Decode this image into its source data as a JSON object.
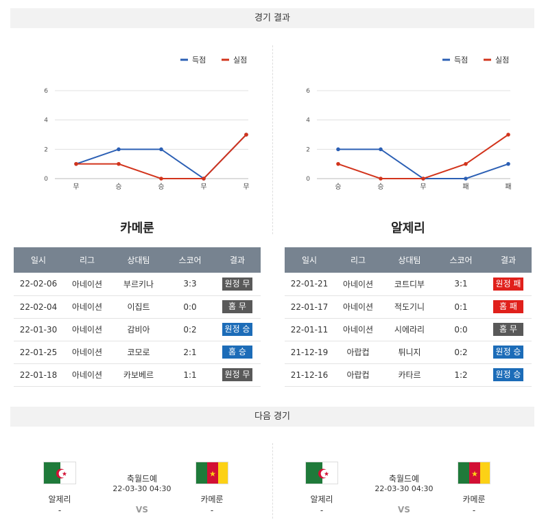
{
  "sections": {
    "results_title": "경기 결과",
    "next_title": "다음 경기"
  },
  "colors": {
    "scored": "#2b5fb4",
    "conceded": "#d2341c",
    "win": "#1c6cb8",
    "loss": "#e0201b",
    "draw": "#595959"
  },
  "chart_data": [
    {
      "type": "line",
      "categories": [
        "무",
        "승",
        "승",
        "무",
        "무"
      ],
      "series": [
        {
          "name": "득점",
          "values": [
            1,
            2,
            2,
            0,
            3
          ]
        },
        {
          "name": "실점",
          "values": [
            1,
            1,
            0,
            0,
            3
          ]
        }
      ],
      "yticks": [
        "0",
        "2",
        "4",
        "6"
      ],
      "ylim": [
        0,
        6
      ],
      "grid": true,
      "legend": "top-right"
    },
    {
      "type": "line",
      "categories": [
        "승",
        "승",
        "무",
        "패",
        "패"
      ],
      "series": [
        {
          "name": "득점",
          "values": [
            2,
            2,
            0,
            0,
            1
          ]
        },
        {
          "name": "실점",
          "values": [
            1,
            0,
            0,
            1,
            3
          ]
        }
      ],
      "yticks": [
        "0",
        "2",
        "4",
        "6"
      ],
      "ylim": [
        0,
        6
      ],
      "grid": true,
      "legend": "top-right"
    }
  ],
  "table_headers": [
    "일시",
    "리그",
    "상대팀",
    "스코어",
    "결과"
  ],
  "teams": [
    {
      "name": "카메룬",
      "rows": [
        {
          "date": "22-02-06",
          "league": "아네이션",
          "opponent": "부르키나",
          "score": "3:3",
          "result": "원정 무",
          "kind": "draw"
        },
        {
          "date": "22-02-04",
          "league": "아네이션",
          "opponent": "이집트",
          "score": "0:0",
          "result": "홈 무",
          "kind": "draw"
        },
        {
          "date": "22-01-30",
          "league": "아네이션",
          "opponent": "감비아",
          "score": "0:2",
          "result": "원정 승",
          "kind": "win"
        },
        {
          "date": "22-01-25",
          "league": "아네이션",
          "opponent": "코모로",
          "score": "2:1",
          "result": "홈 승",
          "kind": "win"
        },
        {
          "date": "22-01-18",
          "league": "아네이션",
          "opponent": "카보베르",
          "score": "1:1",
          "result": "원정 무",
          "kind": "draw"
        }
      ]
    },
    {
      "name": "알제리",
      "rows": [
        {
          "date": "22-01-21",
          "league": "아네이션",
          "opponent": "코트디부",
          "score": "3:1",
          "result": "원정 패",
          "kind": "loss"
        },
        {
          "date": "22-01-17",
          "league": "아네이션",
          "opponent": "적도기니",
          "score": "0:1",
          "result": "홈 패",
          "kind": "loss"
        },
        {
          "date": "22-01-11",
          "league": "아네이션",
          "opponent": "시에라리",
          "score": "0:0",
          "result": "홈 무",
          "kind": "draw"
        },
        {
          "date": "21-12-19",
          "league": "아랍컵",
          "opponent": "튀니지",
          "score": "0:2",
          "result": "원정 승",
          "kind": "win"
        },
        {
          "date": "21-12-16",
          "league": "아랍컵",
          "opponent": "카타르",
          "score": "1:2",
          "result": "원정 승",
          "kind": "win"
        }
      ]
    }
  ],
  "next_matches": [
    {
      "home": "알제리",
      "away": "카메룬",
      "home_extra": "-",
      "away_extra": "-",
      "league": "축월드예",
      "time": "22-03-30 04:30",
      "vs": "VS"
    },
    {
      "home": "알제리",
      "away": "카메룬",
      "home_extra": "-",
      "away_extra": "-",
      "league": "축월드예",
      "time": "22-03-30 04:30",
      "vs": "VS"
    }
  ]
}
